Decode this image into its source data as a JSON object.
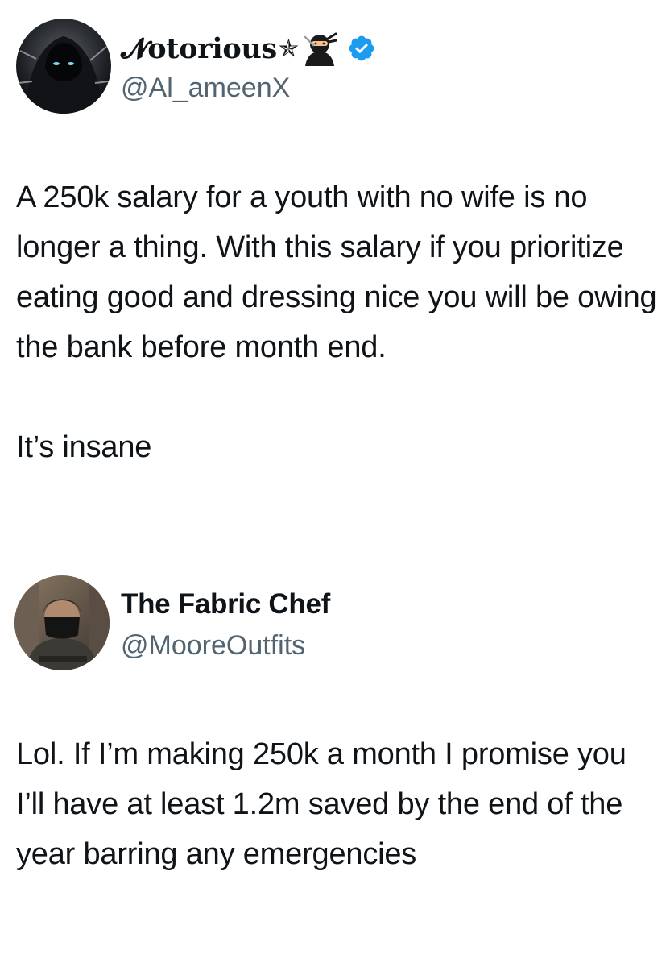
{
  "tweets": [
    {
      "display_name": "𝓝otorious",
      "name_symbol": "✯",
      "ninja_emoji": "ninja-icon",
      "verified": true,
      "verified_color": "#1d9bf0",
      "handle": "@Al_ameenX",
      "paragraphs": [
        "A 250k salary for a youth with no wife is no longer a thing. With this salary if you prioritize eating good and dressing nice you will be owing the bank before month end.",
        "It’s insane"
      ]
    },
    {
      "display_name": "The Fabric Chef",
      "handle": "@MooreOutfits",
      "verified": false,
      "paragraphs": [
        "Lol. If I’m making 250k a month I promise you I’ll have at least 1.2m saved by the end of the year barring any emergencies"
      ]
    }
  ]
}
